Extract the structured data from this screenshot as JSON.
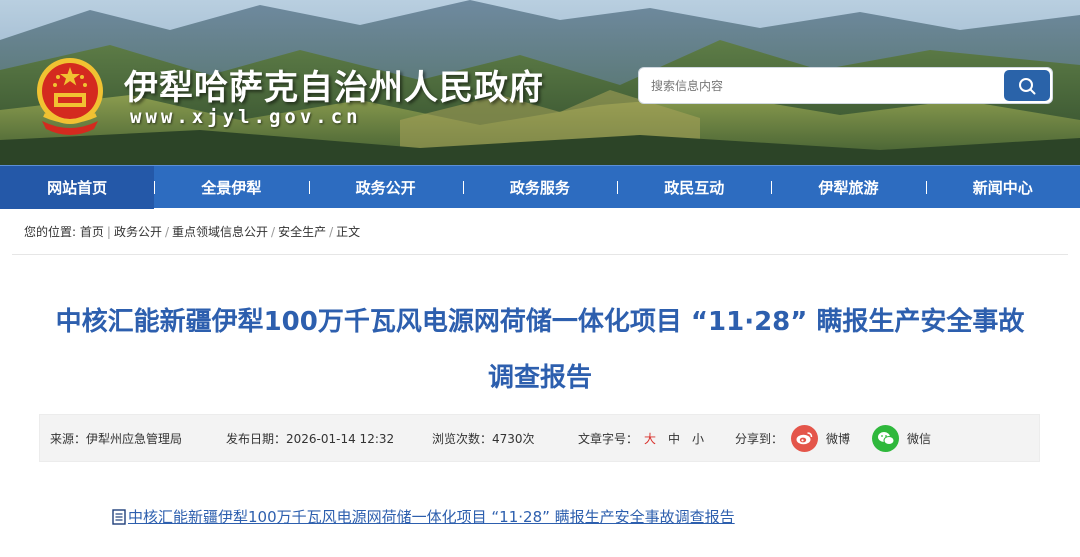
{
  "header": {
    "site_title": "伊犁哈萨克自治州人民政府",
    "site_url": "www.xjyl.gov.cn",
    "search_placeholder": "搜索信息内容",
    "emblem_icon": "national-emblem-icon",
    "search_icon": "search-icon"
  },
  "nav": {
    "items": [
      "网站首页",
      "全景伊犁",
      "政务公开",
      "政务服务",
      "政民互动",
      "伊犁旅游",
      "新闻中心"
    ]
  },
  "breadcrumb": {
    "prefix": "您的位置:",
    "items": [
      "首页",
      "政务公开",
      "重点领域信息公开",
      "安全生产",
      "正文"
    ]
  },
  "article": {
    "title_line1": "中核汇能新疆伊犁100万千瓦风电源网荷储一体化项目 “11·28” 瞒报生产安全事故",
    "title_line2": "调查报告",
    "meta": {
      "source": "来源：伊犁州应急管理局",
      "date": "发布日期：2026-01-14 12:32",
      "views": "浏览次数：4730次",
      "font_label": "文章字号：",
      "font_sizes": [
        "大",
        "中",
        "小"
      ],
      "share_label": "分享到：",
      "weibo_label": "微博",
      "wechat_label": "微信"
    },
    "attachment": "中核汇能新疆伊犁100万千瓦风电源网荷储一体化项目 “11·28” 瞒报生产安全事故调查报告",
    "attachment_icon": "document-icon"
  },
  "colors": {
    "nav_bg": "#2d6cc0",
    "title_blue": "#2d5fae",
    "search_button": "#2a63a9",
    "weibo": "#e4554a",
    "wechat": "#2fb83c"
  }
}
